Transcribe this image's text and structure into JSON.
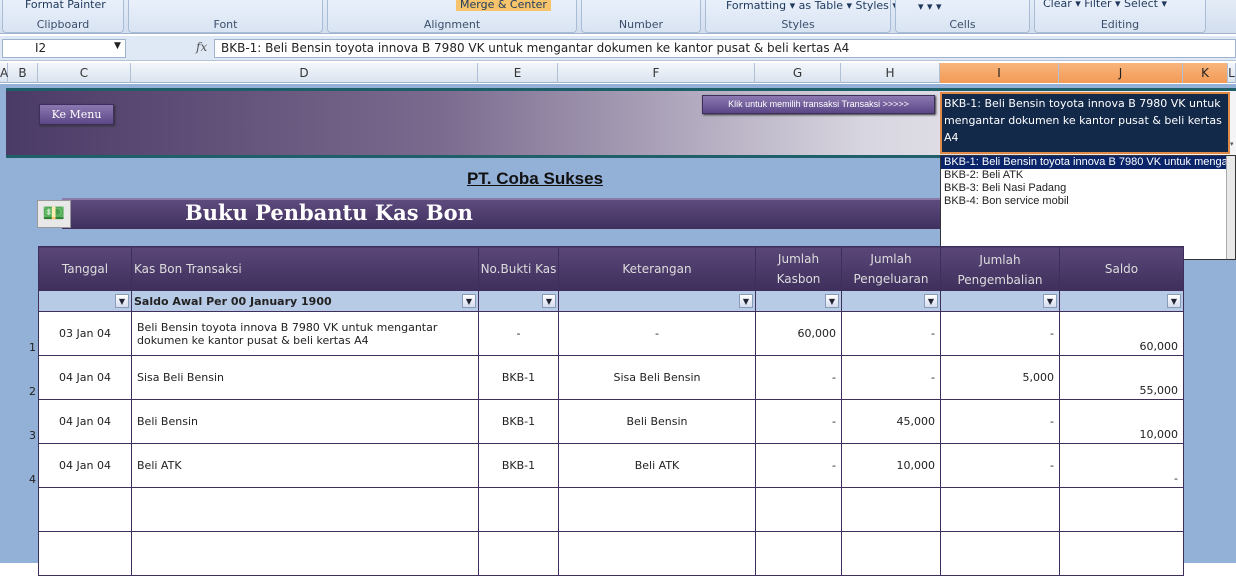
{
  "ribbon": {
    "groups": [
      {
        "label": "Clipboard",
        "item": "Format Painter"
      },
      {
        "label": "Font",
        "item": ""
      },
      {
        "label": "Alignment",
        "item": "Merge & Center"
      },
      {
        "label": "Number",
        "item": ""
      },
      {
        "label": "Styles",
        "item": "Formatting ▾  as Table ▾  Styles ▾"
      },
      {
        "label": "Cells",
        "item": "▾          ▾          ▾"
      },
      {
        "label": "Editing",
        "item": "Clear ▾               Filter ▾  Select ▾"
      }
    ]
  },
  "formula_bar": {
    "name_box": "I2",
    "fx": "fx",
    "formula": "BKB-1: Beli Bensin toyota innova B 7980 VK untuk mengantar dokumen ke kantor pusat & beli kertas A4"
  },
  "columns": [
    "A",
    "B",
    "C",
    "D",
    "E",
    "F",
    "G",
    "H",
    "I",
    "J",
    "K",
    "L"
  ],
  "banner": {
    "menu_button": "Ke Menu",
    "select_button": "Klik untuk memilih transaksi  Transaksi   >>>>>"
  },
  "dropdown": {
    "value": "BKB-1: Beli Bensin toyota innova B 7980 VK untuk mengantar dokumen ke kantor pusat & beli kertas A4",
    "options": [
      "BKB-1: Beli Bensin toyota innova B 7980 VK untuk mengantar dokumen ke kantor pusat & beli kertas A4",
      "BKB-2: Beli ATK",
      "BKB-3: Beli Nasi Padang",
      "BKB-4: Bon service mobil"
    ]
  },
  "company": "PT. Coba Sukses",
  "title": "Buku Penbantu Kas Bon",
  "table": {
    "headers": [
      "Tanggal",
      "Kas Bon Transaksi",
      "No.Bukti Kas",
      "Keterangan",
      "Jumlah Kasbon",
      "Jumlah Pengeluaran",
      "Jumlah Pengembalian",
      "Saldo"
    ],
    "opening": "Saldo Awal Per 00 January 1900",
    "rows": [
      {
        "n": "1",
        "tanggal": "03 Jan 04",
        "transaksi": "Beli Bensin toyota innova B 7980 VK untuk mengantar dokumen ke kantor pusat & beli kertas A4",
        "bukti": "-",
        "ket": "-",
        "kasbon": "60,000",
        "pengeluaran": "-",
        "pengembalian": "-",
        "saldo": "60,000"
      },
      {
        "n": "2",
        "tanggal": "04 Jan 04",
        "transaksi": "Sisa Beli Bensin",
        "bukti": "BKB-1",
        "ket": "Sisa Beli Bensin",
        "kasbon": "-",
        "pengeluaran": "-",
        "pengembalian": "5,000",
        "saldo": "55,000"
      },
      {
        "n": "3",
        "tanggal": "04 Jan 04",
        "transaksi": "Beli Bensin",
        "bukti": "BKB-1",
        "ket": "Beli Bensin",
        "kasbon": "-",
        "pengeluaran": "45,000",
        "pengembalian": "-",
        "saldo": "10,000"
      },
      {
        "n": "4",
        "tanggal": "04 Jan 04",
        "transaksi": "Beli ATK",
        "bukti": "BKB-1",
        "ket": "Beli ATK",
        "kasbon": "-",
        "pengeluaran": "10,000",
        "pengembalian": "-",
        "saldo": "-"
      }
    ]
  }
}
